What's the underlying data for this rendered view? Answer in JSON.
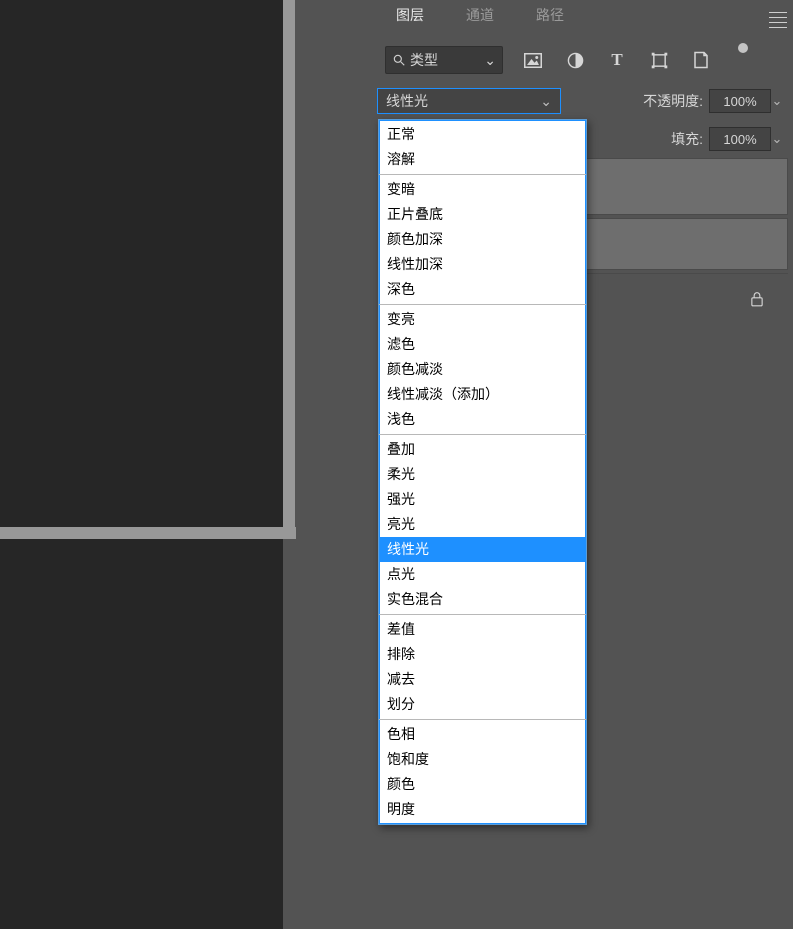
{
  "tabs": {
    "layers": "图层",
    "channels": "通道",
    "paths": "路径"
  },
  "filter_label": "类型",
  "blend_selected": "线性光",
  "opacity_label": "不透明度:",
  "opacity_value": "100%",
  "fill_label": "填充:",
  "fill_value": "100%",
  "dropdown_groups": [
    {
      "items": [
        "正常",
        "溶解"
      ]
    },
    {
      "items": [
        "变暗",
        "正片叠底",
        "颜色加深",
        "线性加深",
        "深色"
      ]
    },
    {
      "items": [
        "变亮",
        "滤色",
        "颜色减淡",
        "线性减淡（添加）",
        "浅色"
      ]
    },
    {
      "items": [
        "叠加",
        "柔光",
        "强光",
        "亮光",
        "线性光",
        "点光",
        "实色混合"
      ]
    },
    {
      "items": [
        "差值",
        "排除",
        "减去",
        "划分"
      ]
    },
    {
      "items": [
        "色相",
        "饱和度",
        "颜色",
        "明度"
      ]
    }
  ],
  "selected_item": "线性光",
  "icons": {
    "search": "search-icon",
    "image": "image-icon",
    "adjust": "adjust-icon",
    "text": "text-icon",
    "shape": "shape-icon",
    "smart": "smart-object-icon",
    "dot": "dot-icon",
    "lock": "lock-icon",
    "chev": "chevron-down-icon",
    "menu": "menu-icon"
  }
}
